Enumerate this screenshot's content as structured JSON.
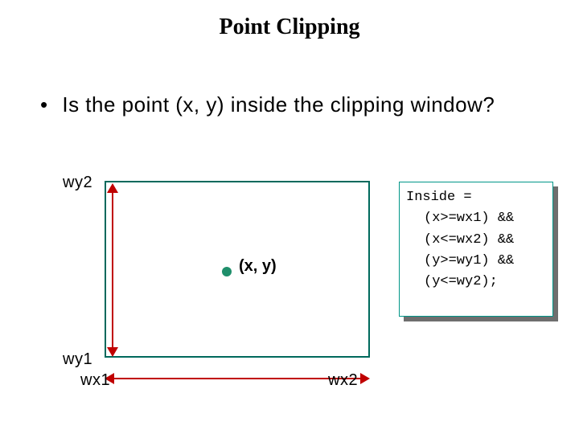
{
  "title": "Point Clipping",
  "bullet": "Is the point (x, y) inside the clipping window?",
  "labels": {
    "wy2": "wy2",
    "wy1": "wy1",
    "wx1": "wx1",
    "wx2": "wx2",
    "point": "(x, y)"
  },
  "code": {
    "l0": "Inside =",
    "l1": "(x>=wx1) &&",
    "l2": "(x<=wx2) &&",
    "l3": "(y>=wy1) &&",
    "l4": "(y<=wy2);"
  }
}
